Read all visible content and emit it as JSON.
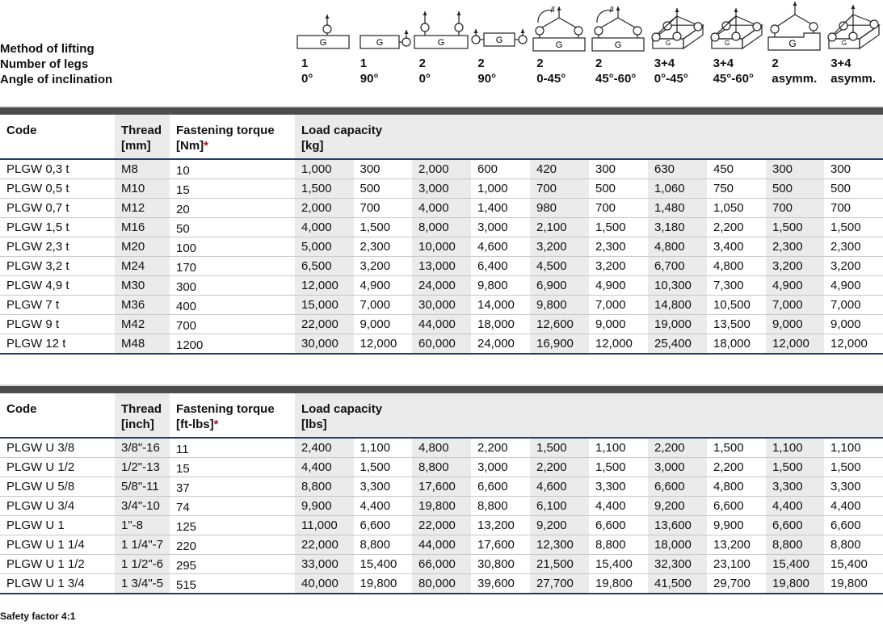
{
  "header_labels": {
    "method": "Method of lifting",
    "legs": "Number of legs",
    "angle": "Angle of inclination"
  },
  "methods": [
    {
      "icon": "single-leg-vertical-lift-icon",
      "legs": "1",
      "angle": "0°"
    },
    {
      "icon": "single-leg-side-lift-icon",
      "legs": "1",
      "angle": "90°"
    },
    {
      "icon": "two-leg-vertical-lift-icon",
      "legs": "2",
      "angle": "0°"
    },
    {
      "icon": "two-leg-side-lift-icon",
      "legs": "2",
      "angle": "90°"
    },
    {
      "icon": "two-leg-sling-0-45-icon",
      "legs": "2",
      "angle": "0-45°"
    },
    {
      "icon": "two-leg-sling-45-60-icon",
      "legs": "2",
      "angle": "45°-60°"
    },
    {
      "icon": "four-leg-sling-0-45-icon",
      "legs": "3+4",
      "angle": "0°-45°"
    },
    {
      "icon": "four-leg-sling-45-60-icon",
      "legs": "3+4",
      "angle": "45°-60°"
    },
    {
      "icon": "two-leg-asymmetric-sling-icon",
      "legs": "2",
      "angle": "asymm."
    },
    {
      "icon": "four-leg-asymmetric-sling-icon",
      "legs": "3+4",
      "angle": "asymm."
    }
  ],
  "metric_table": {
    "headers": {
      "code": "Code",
      "thread": [
        "Thread",
        "[mm]"
      ],
      "torque": [
        "Fastening torque",
        "[Nm]"
      ],
      "torque_mark": "*",
      "load": [
        "Load capacity",
        "[kg]"
      ]
    },
    "rows": [
      {
        "code": "PLGW 0,3 t",
        "thread": "M8",
        "torque": "10",
        "loads": [
          "1,000",
          "300",
          "2,000",
          "600",
          "420",
          "300",
          "630",
          "450",
          "300",
          "300"
        ]
      },
      {
        "code": "PLGW 0,5 t",
        "thread": "M10",
        "torque": "15",
        "loads": [
          "1,500",
          "500",
          "3,000",
          "1,000",
          "700",
          "500",
          "1,060",
          "750",
          "500",
          "500"
        ]
      },
      {
        "code": "PLGW 0,7 t",
        "thread": "M12",
        "torque": "20",
        "loads": [
          "2,000",
          "700",
          "4,000",
          "1,400",
          "980",
          "700",
          "1,480",
          "1,050",
          "700",
          "700"
        ]
      },
      {
        "code": "PLGW 1,5 t",
        "thread": "M16",
        "torque": "50",
        "loads": [
          "4,000",
          "1,500",
          "8,000",
          "3,000",
          "2,100",
          "1,500",
          "3,180",
          "2,200",
          "1,500",
          "1,500"
        ]
      },
      {
        "code": "PLGW 2,3 t",
        "thread": "M20",
        "torque": "100",
        "loads": [
          "5,000",
          "2,300",
          "10,000",
          "4,600",
          "3,200",
          "2,300",
          "4,800",
          "3,400",
          "2,300",
          "2,300"
        ]
      },
      {
        "code": "PLGW 3,2 t",
        "thread": "M24",
        "torque": "170",
        "loads": [
          "6,500",
          "3,200",
          "13,000",
          "6,400",
          "4,500",
          "3,200",
          "6,700",
          "4,800",
          "3,200",
          "3,200"
        ]
      },
      {
        "code": "PLGW 4,9 t",
        "thread": "M30",
        "torque": "300",
        "loads": [
          "12,000",
          "4,900",
          "24,000",
          "9,800",
          "6,900",
          "4,900",
          "10,300",
          "7,300",
          "4,900",
          "4,900"
        ]
      },
      {
        "code": "PLGW 7 t",
        "thread": "M36",
        "torque": "400",
        "loads": [
          "15,000",
          "7,000",
          "30,000",
          "14,000",
          "9,800",
          "7,000",
          "14,800",
          "10,500",
          "7,000",
          "7,000"
        ]
      },
      {
        "code": "PLGW 9 t",
        "thread": "M42",
        "torque": "700",
        "loads": [
          "22,000",
          "9,000",
          "44,000",
          "18,000",
          "12,600",
          "9,000",
          "19,000",
          "13,500",
          "9,000",
          "9,000"
        ]
      },
      {
        "code": "PLGW 12 t",
        "thread": "M48",
        "torque": "1200",
        "loads": [
          "30,000",
          "12,000",
          "60,000",
          "24,000",
          "16,900",
          "12,000",
          "25,400",
          "18,000",
          "12,000",
          "12,000"
        ]
      }
    ]
  },
  "imperial_table": {
    "headers": {
      "code": "Code",
      "thread": [
        "Thread",
        "[inch]"
      ],
      "torque": [
        "Fastening torque",
        "[ft-lbs]"
      ],
      "torque_mark": "*",
      "load": [
        "Load capacity",
        "[lbs]"
      ]
    },
    "rows": [
      {
        "code": "PLGW U 3/8",
        "thread": "3/8\"-16",
        "torque": "11",
        "loads": [
          "2,400",
          "1,100",
          "4,800",
          "2,200",
          "1,500",
          "1,100",
          "2,200",
          "1,500",
          "1,100",
          "1,100"
        ]
      },
      {
        "code": "PLGW U 1/2",
        "thread": "1/2\"-13",
        "torque": "15",
        "loads": [
          "4,400",
          "1,500",
          "8,800",
          "3,000",
          "2,200",
          "1,500",
          "3,000",
          "2,200",
          "1,500",
          "1,500"
        ]
      },
      {
        "code": "PLGW U 5/8",
        "thread": "5/8\"-11",
        "torque": "37",
        "loads": [
          "8,800",
          "3,300",
          "17,600",
          "6,600",
          "4,600",
          "3,300",
          "6,600",
          "4,800",
          "3,300",
          "3,300"
        ]
      },
      {
        "code": "PLGW U 3/4",
        "thread": "3/4\"-10",
        "torque": "74",
        "loads": [
          "9,900",
          "4,400",
          "19,800",
          "8,800",
          "6,100",
          "4,400",
          "9,200",
          "6,600",
          "4,400",
          "4,400"
        ]
      },
      {
        "code": "PLGW U 1",
        "thread": "1\"-8",
        "torque": "125",
        "loads": [
          "11,000",
          "6,600",
          "22,000",
          "13,200",
          "9,200",
          "6,600",
          "13,600",
          "9,900",
          "6,600",
          "6,600"
        ]
      },
      {
        "code": "PLGW U 1 1/4",
        "thread": "1 1/4\"-7",
        "torque": "220",
        "loads": [
          "22,000",
          "8,800",
          "44,000",
          "17,600",
          "12,300",
          "8,800",
          "18,000",
          "13,200",
          "8,800",
          "8,800"
        ]
      },
      {
        "code": "PLGW U 1 1/2",
        "thread": "1 1/2\"-6",
        "torque": "295",
        "loads": [
          "33,000",
          "15,400",
          "66,000",
          "30,800",
          "21,500",
          "15,400",
          "32,300",
          "23,100",
          "15,400",
          "15,400"
        ]
      },
      {
        "code": "PLGW U 1 3/4",
        "thread": "1 3/4\"-5",
        "torque": "515",
        "loads": [
          "40,000",
          "19,800",
          "80,000",
          "39,600",
          "27,700",
          "19,800",
          "41,500",
          "29,700",
          "19,800",
          "19,800"
        ]
      }
    ]
  },
  "footnote": "Safety factor 4:1",
  "colors": {
    "header_bar": "#4d4d4d",
    "rule_blue": "#1f3f6b",
    "shade": "#ebebeb",
    "asterisk": "#b3121c"
  }
}
